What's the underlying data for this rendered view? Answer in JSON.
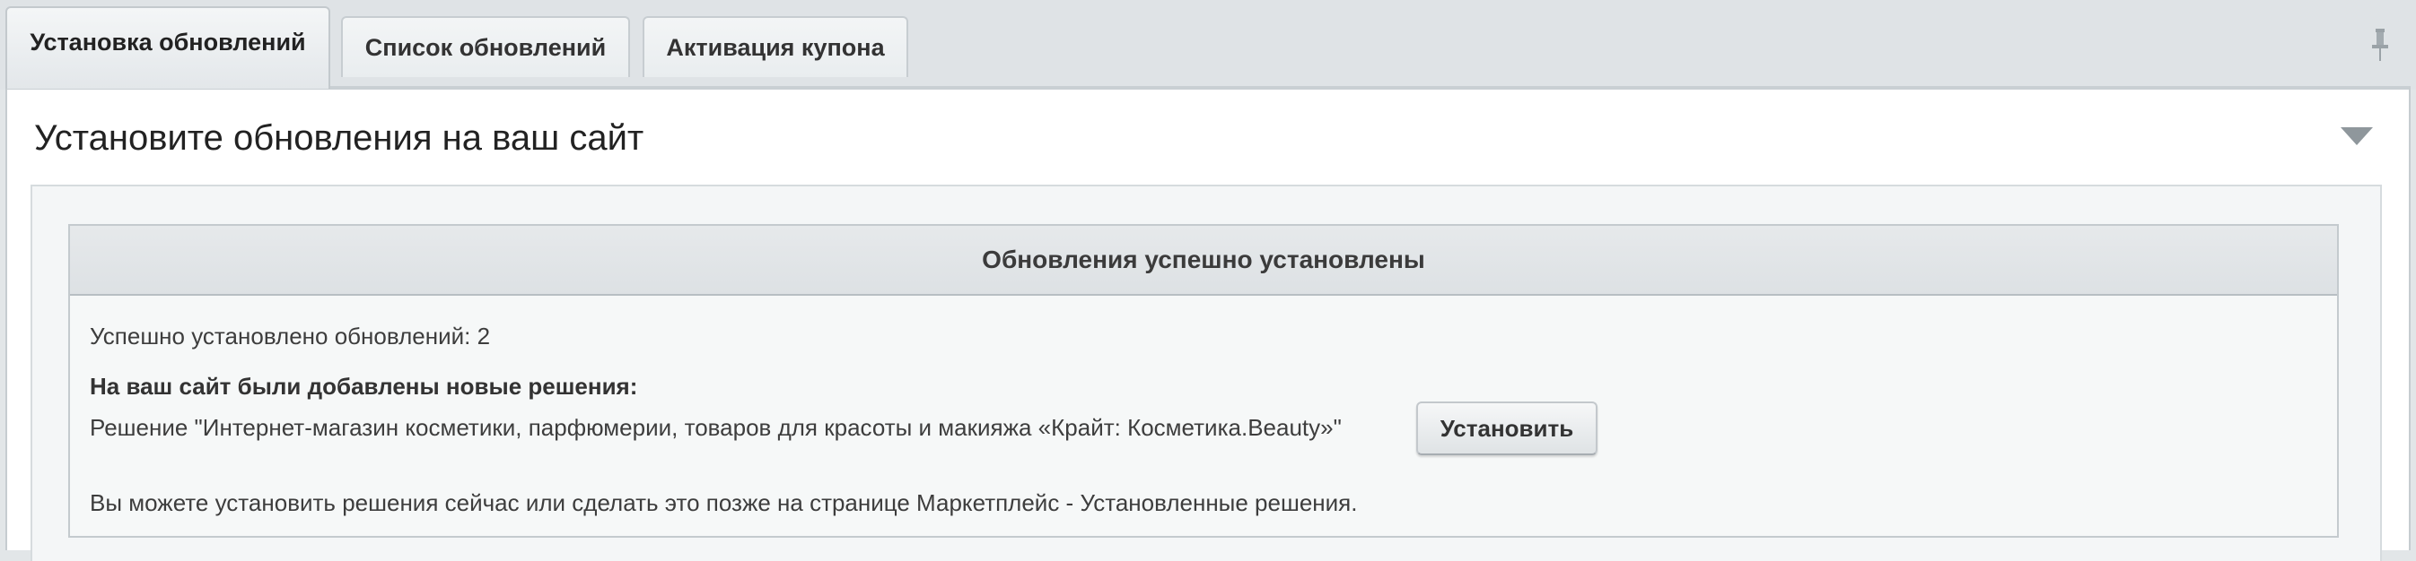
{
  "tabs": [
    {
      "label": "Установка обновлений",
      "active": true
    },
    {
      "label": "Список обновлений",
      "active": false
    },
    {
      "label": "Активация купона",
      "active": false
    }
  ],
  "icons": {
    "pin": "pin-icon",
    "collapse": "triangle-down-icon"
  },
  "panel": {
    "title": "Установите обновления на ваш сайт"
  },
  "notice": {
    "header": "Обновления успешно установлены",
    "installed_count_text": "Успешно установлено обновлений: 2",
    "new_solutions_heading": "На ваш сайт были добавлены новые решения:",
    "solution_text": "Решение \"Интернет-магазин косметики, парфюмерии, товаров для красоты и макияжа «Крайт: Косметика.Beauty»\"",
    "install_button": "Установить",
    "footer_text": "Вы можете установить решения сейчас или сделать это позже на странице Маркетплейс - Установленные решения."
  },
  "colors": {
    "background": "#e2e6e8",
    "panel": "#ffffff",
    "notice_header": "#e2e6e8"
  }
}
